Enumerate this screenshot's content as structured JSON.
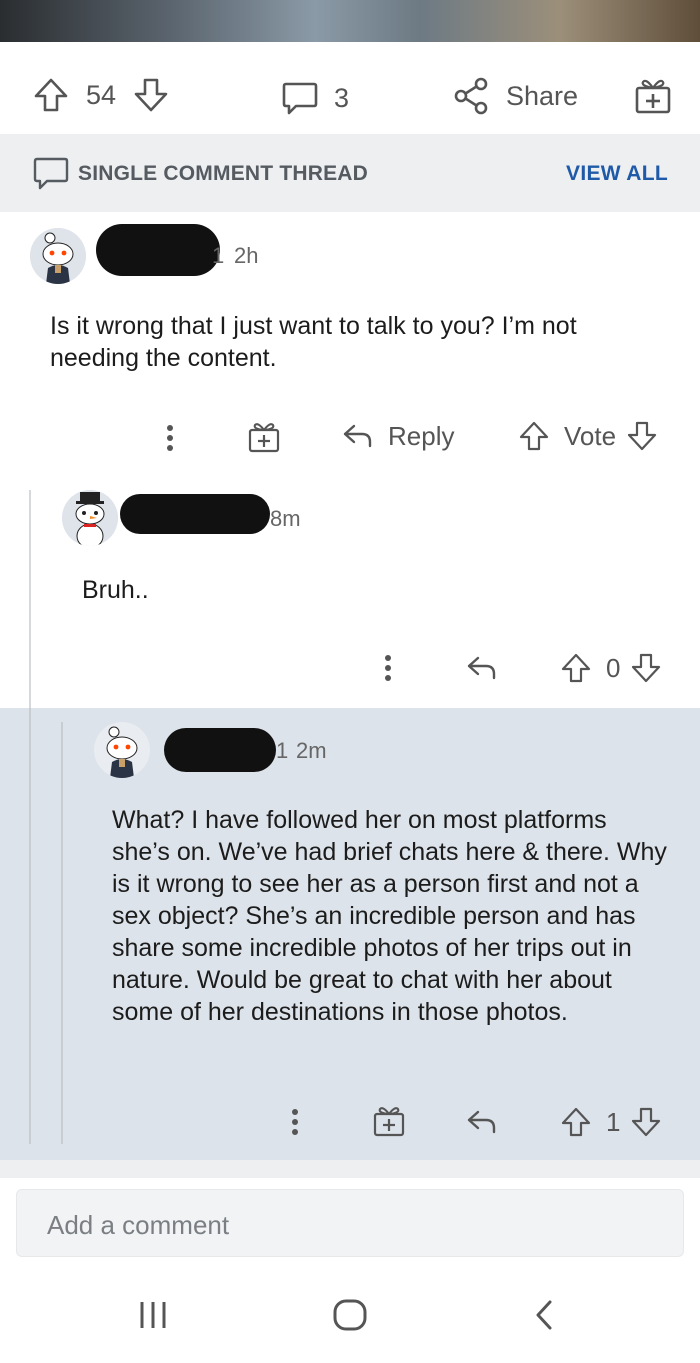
{
  "post_actions": {
    "upvotes": "54",
    "comments": "3",
    "share_label": "Share"
  },
  "thread_bar": {
    "title": "SINGLE COMMENT THREAD",
    "view_all": "VIEW ALL"
  },
  "comments": [
    {
      "time": "2h",
      "prefix": "1",
      "body": "Is it wrong that I just want to talk to you? I’m not needing the content.",
      "reply_label": "Reply",
      "vote_label": "Vote"
    },
    {
      "time": "8m",
      "body": "Bruh..",
      "score": "0"
    },
    {
      "time": "2m",
      "prefix": "1",
      "body": "What? I have followed her on most platforms she’s on. We’ve had brief chats here & there. Why is it wrong to see her as a person first and not a sex object? She’s an incredible person and has share some incredible photos of her trips out in nature. Would be great to chat with her about some of her destinations in those photos.",
      "score": "1"
    }
  ],
  "composer": {
    "placeholder": "Add a comment"
  },
  "colors": {
    "accent_blue": "#1f5aa8",
    "highlight_bg": "#dde3ea",
    "icon_gray": "#555555"
  }
}
